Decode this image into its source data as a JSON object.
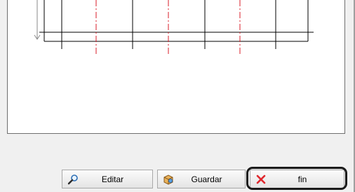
{
  "buttons": {
    "editar": {
      "label": "Editar",
      "icon": "magnifier-icon"
    },
    "guardar": {
      "label": "Guardar",
      "icon": "save-box-icon"
    },
    "fin": {
      "label": "fin",
      "icon": "close-x-icon"
    }
  },
  "colors": {
    "dimension_line": "#000000",
    "center_line": "#d81e2a",
    "highlight": "#1a1a1a",
    "fin_icon": "#e0282e"
  }
}
